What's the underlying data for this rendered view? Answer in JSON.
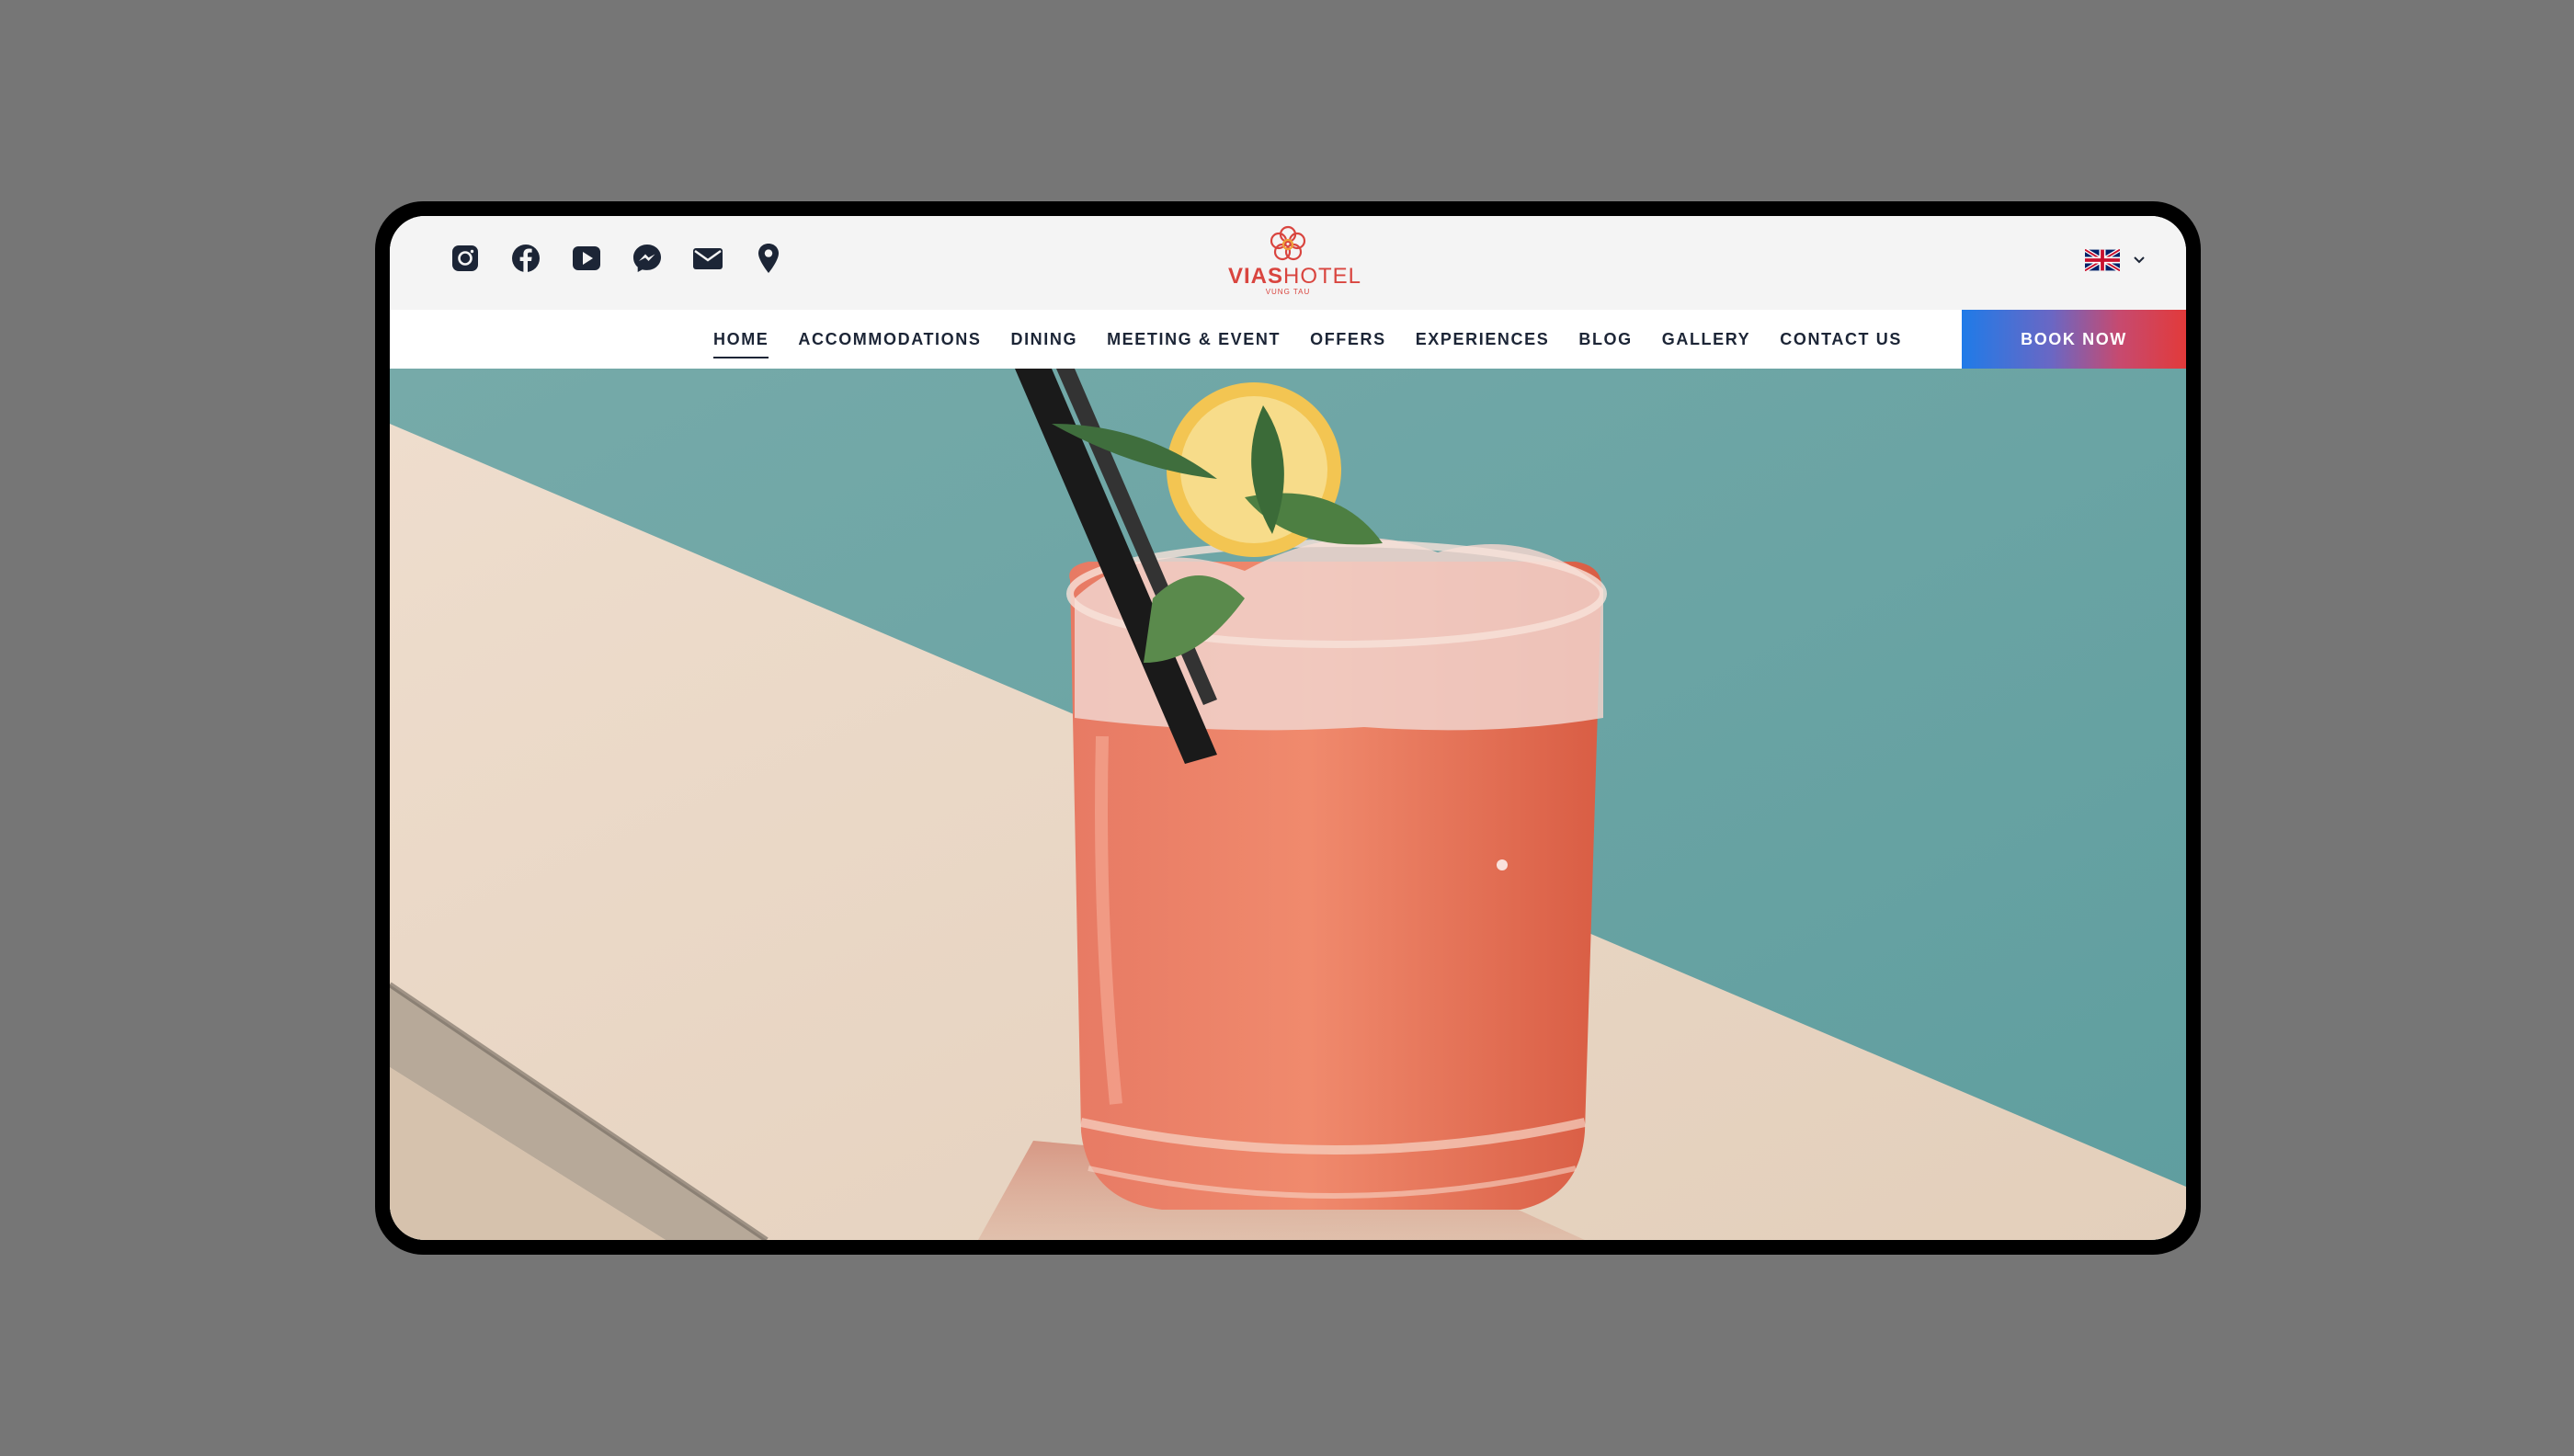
{
  "brand": {
    "name_bold": "VIAS",
    "name_light": "HOTEL",
    "subtitle": "VUNG TAU",
    "color": "#d9453f"
  },
  "social": [
    {
      "name": "instagram-icon"
    },
    {
      "name": "facebook-icon"
    },
    {
      "name": "youtube-icon"
    },
    {
      "name": "messenger-icon"
    },
    {
      "name": "email-icon"
    },
    {
      "name": "location-pin-icon"
    }
  ],
  "language": {
    "current": "en-gb",
    "icon": "uk-flag-icon"
  },
  "nav": {
    "items": [
      {
        "label": "HOME",
        "active": true
      },
      {
        "label": "ACCOMMODATIONS"
      },
      {
        "label": "DINING"
      },
      {
        "label": "MEETING & EVENT"
      },
      {
        "label": "OFFERS"
      },
      {
        "label": "EXPERIENCES"
      },
      {
        "label": "BLOG"
      },
      {
        "label": "GALLERY"
      },
      {
        "label": "CONTACT US"
      }
    ],
    "book_label": "BOOK NOW"
  },
  "colors": {
    "nav_text": "#1c2536",
    "book_gradient_start": "#1f7be8",
    "book_gradient_end": "#e23a3a",
    "hero_water": "#6ba4a6",
    "hero_stone": "#e8d6c4",
    "drink": "#e8674e"
  }
}
